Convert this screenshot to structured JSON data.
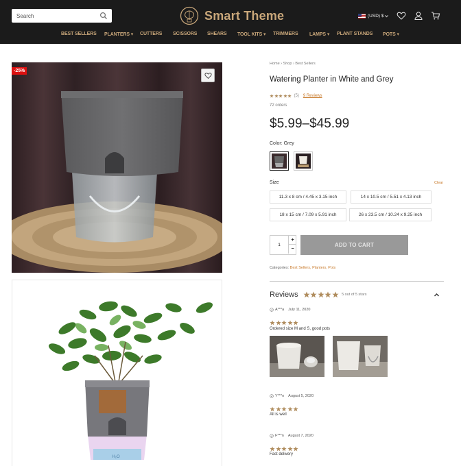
{
  "header": {
    "search_placeholder": "Search",
    "brand": "Smart Theme",
    "currency": "(USD) $",
    "icons": [
      "search-icon",
      "brain-logo-icon",
      "us-flag-icon",
      "heart-icon",
      "user-icon",
      "cart-icon"
    ]
  },
  "nav": [
    {
      "label": "BEST SELLERS",
      "caret": false
    },
    {
      "label": "PLANTERS",
      "caret": true
    },
    {
      "label": "CUTTERS",
      "caret": false
    },
    {
      "label": "SCISSORS",
      "caret": false
    },
    {
      "label": "SHEARS",
      "caret": false
    },
    {
      "label": "TOOL KITS",
      "caret": true
    },
    {
      "label": "TRIMMERS",
      "caret": false
    },
    {
      "label": "LAMPS",
      "caret": true
    },
    {
      "label": "PLANT STANDS",
      "caret": false
    },
    {
      "label": "POTS",
      "caret": true
    }
  ],
  "gallery": {
    "discount_badge": "-25%",
    "water_label": "H₂O"
  },
  "product": {
    "breadcrumb": [
      "Home",
      "Shop",
      "Best Sellers"
    ],
    "title": "Watering Planter in White and Grey",
    "rating_count": "(5)",
    "reviews_link": "9 Reviews",
    "orders": "72 orders",
    "price": "$5.99–$45.99",
    "color_label": "Color: Grey",
    "size_label": "Size",
    "clear_label": "Clear",
    "sizes": [
      "11.3 x 8 cm / 4.45 x 3.15 inch",
      "14 x 10.5 cm / 5.51 x 4.13 inch",
      "18 x 15 cm / 7.09 x 5.91 inch",
      "26 x 23.5 cm / 10.24 x 9.25 inch"
    ],
    "quantity": "1",
    "plus": "+",
    "minus": "−",
    "add_to_cart": "ADD TO CART",
    "categories_label": "Categories:",
    "categories": "Best Sellers, Planters, Pots",
    "rating": 5,
    "accent_color": "#c9a77a",
    "link_color": "#c87a2b"
  },
  "reviews": {
    "heading": "Reviews",
    "summary": "5 out of 5 stars",
    "items": [
      {
        "author": "A***a",
        "date": "July 11, 2020",
        "text": "Ordered size M and S, good pots",
        "stars": 5
      },
      {
        "author": "Y***o",
        "date": "August 5, 2020",
        "text": "All is well",
        "stars": 5
      },
      {
        "author": "F***n",
        "date": "August 7, 2020",
        "text": "Fast delivery",
        "stars": 5
      }
    ]
  }
}
